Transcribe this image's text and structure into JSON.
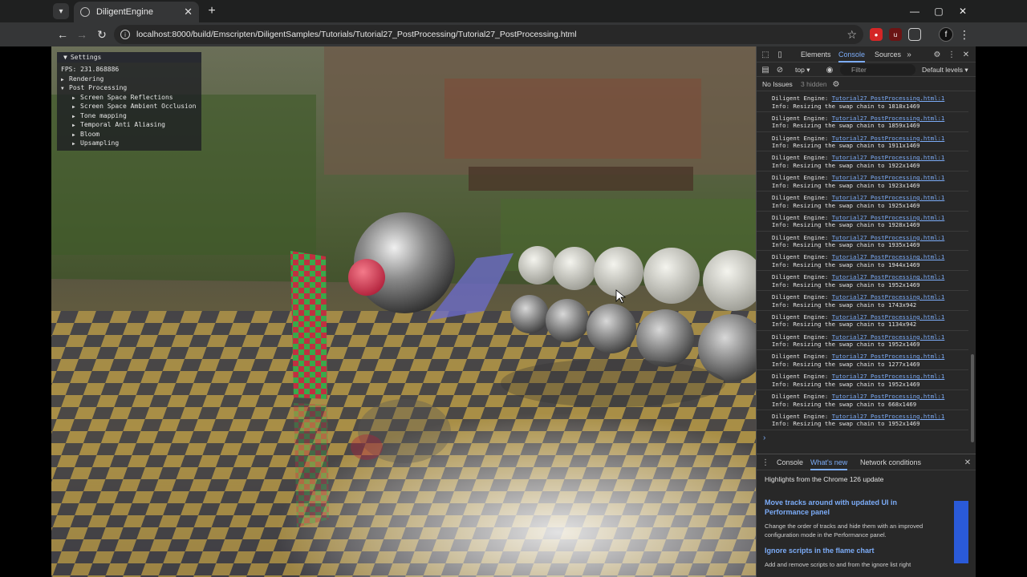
{
  "browser": {
    "tab_title": "DiligentEngine",
    "url": "localhost:8000/build/Emscripten/DiligentSamples/Tutorials/Tutorial27_PostProcessing/Tutorial27_PostProcessing.html"
  },
  "settings": {
    "title": "Settings",
    "fps": "FPS: 231.868886",
    "items": [
      {
        "label": "Rendering",
        "expanded": false,
        "level": 0
      },
      {
        "label": "Post Processing",
        "expanded": true,
        "level": 0
      },
      {
        "label": "Screen Space Reflections",
        "expanded": false,
        "level": 1
      },
      {
        "label": "Screen Space Ambient Occlusion",
        "expanded": false,
        "level": 1
      },
      {
        "label": "Tone mapping",
        "expanded": false,
        "level": 1
      },
      {
        "label": "Temporal Anti Aliasing",
        "expanded": false,
        "level": 1
      },
      {
        "label": "Bloom",
        "expanded": false,
        "level": 1
      },
      {
        "label": "Upsampling",
        "expanded": false,
        "level": 1
      }
    ]
  },
  "devtools": {
    "tabs": [
      "Elements",
      "Console",
      "Sources"
    ],
    "active_tab": "Console",
    "context": "top",
    "filter_placeholder": "Filter",
    "levels": "Default levels",
    "issues": "No Issues",
    "hidden": "3 hidden",
    "log_prefix": "Diligent Engine: ",
    "log_source": "Tutorial27_PostProcessing.html:1",
    "log_info_prefix": "Info: Resizing the swap chain to ",
    "logs": [
      "1818x1469",
      "1859x1469",
      "1911x1469",
      "1922x1469",
      "1923x1469",
      "1925x1469",
      "1928x1469",
      "1935x1469",
      "1944x1469",
      "1952x1469",
      "1743x942",
      "1134x942",
      "1952x1469",
      "1277x1469",
      "1952x1469",
      "668x1469",
      "1952x1469"
    ],
    "drawer": {
      "tabs": [
        "Console",
        "What's new",
        "Network conditions"
      ],
      "active_tab": "What's new",
      "highlight_header": "Highlights from the Chrome 126 update",
      "item1_title": "Move tracks around with updated UI in Performance panel",
      "item1_text": "Change the order of tracks and hide them with an improved configuration mode in the Performance panel.",
      "item2_title": "Ignore scripts in the flame chart",
      "item2_text": "Add and remove scripts to and from the ignore list right"
    }
  },
  "colors": {
    "accent": "#7cacf8",
    "chrome_bg": "#1f2020",
    "toolbar_bg": "#353637",
    "devtools_bg": "#282828"
  }
}
